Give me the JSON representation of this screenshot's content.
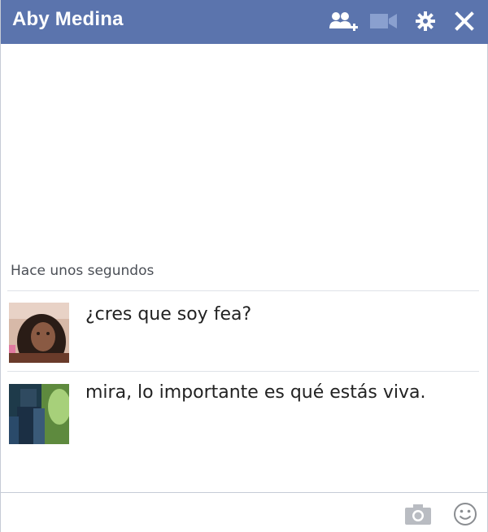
{
  "window": {
    "title": "Aby Medina"
  },
  "header_icons": [
    "add-friends-icon",
    "video-call-icon",
    "gear-icon",
    "close-icon"
  ],
  "conversation": {
    "timestamp": "Hace unos segundos",
    "messages": [
      {
        "sender_avatar": "avatar-girl",
        "text": "¿cres que soy fea?"
      },
      {
        "sender_avatar": "avatar-dark-figure",
        "text": "mira, lo importante es qué estás viva."
      }
    ]
  },
  "footer_icons": [
    "camera-icon",
    "emoji-icon"
  ],
  "colors": {
    "titlebar": "#5b74ad",
    "title_text": "#ffffff",
    "divider": "#dfe2e8",
    "icon_gray": "#8a8d91"
  }
}
